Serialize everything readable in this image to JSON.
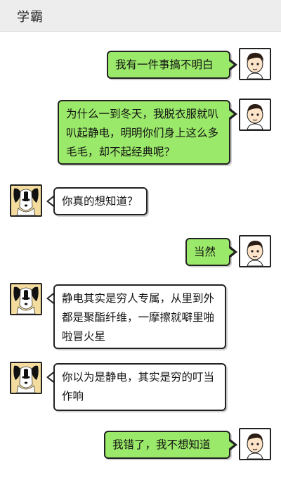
{
  "header": {
    "title": "学霸"
  },
  "me_avatar": "boy-avatar-icon",
  "them_avatar": "dog-avatar-icon",
  "colors": {
    "me_bubble": "#9be96a",
    "them_bubble": "#ffffff",
    "titlebar": "#ededed"
  },
  "messages": [
    {
      "side": "me",
      "text": "我有一件事搞不明白"
    },
    {
      "side": "me",
      "text": "为什么一到冬天，我脱衣服就叭叭起静电，明明你们身上这么多毛毛，却不起经典呢？"
    },
    {
      "side": "them",
      "text": "你真的想知道？"
    },
    {
      "side": "me",
      "text": "当然"
    },
    {
      "side": "them",
      "text": "静电其实是穷人专属，从里到外都是聚酯纤维，一摩擦就噼里啪啦冒火星"
    },
    {
      "side": "them",
      "text": "你以为是静电，其实是穷的叮当作响"
    },
    {
      "side": "me",
      "text": "我错了，我不想知道"
    }
  ]
}
